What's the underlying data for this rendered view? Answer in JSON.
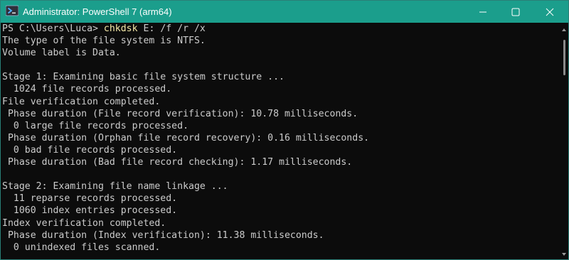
{
  "window": {
    "title": "Administrator: PowerShell 7 (arm64)",
    "accent_color": "#1b9e8c",
    "app_icon": "powershell-icon",
    "controls": [
      "minimize-icon",
      "maximize-icon",
      "close-icon"
    ]
  },
  "console": {
    "prompt": "PS C:\\Users\\Luca> ",
    "command": "chkdsk",
    "args": " E: /f /r /x",
    "lines": [
      "The type of the file system is NTFS.",
      "Volume label is Data.",
      "",
      "Stage 1: Examining basic file system structure ...",
      "  1024 file records processed.",
      "File verification completed.",
      " Phase duration (File record verification): 10.78 milliseconds.",
      "  0 large file records processed.",
      " Phase duration (Orphan file record recovery): 0.16 milliseconds.",
      "  0 bad file records processed.",
      " Phase duration (Bad file record checking): 1.17 milliseconds.",
      "",
      "Stage 2: Examining file name linkage ...",
      "  11 reparse records processed.",
      "  1060 index entries processed.",
      "Index verification completed.",
      " Phase duration (Index verification): 11.38 milliseconds.",
      "  0 unindexed files scanned."
    ]
  }
}
